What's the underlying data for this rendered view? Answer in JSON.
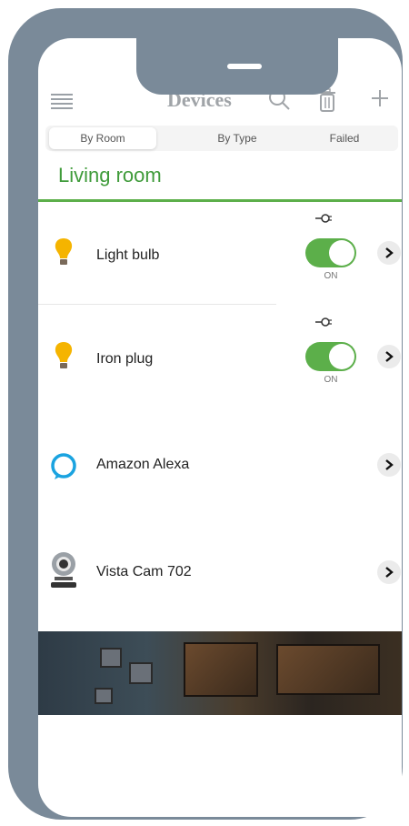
{
  "header": {
    "title": "Devices",
    "icons": [
      "menu-icon",
      "search-icon",
      "trash-icon",
      "add-icon"
    ]
  },
  "tabs": [
    {
      "label": "By Room",
      "active": true
    },
    {
      "label": "By Type",
      "active": false
    },
    {
      "label": "Failed",
      "active": false
    }
  ],
  "section": {
    "title": "Living room"
  },
  "devices": [
    {
      "name": "Light bulb",
      "icon": "lightbulb-icon",
      "toggle": "ON",
      "on": true
    },
    {
      "name": "Iron plug",
      "icon": "lightbulb-icon",
      "toggle": "ON",
      "on": true
    },
    {
      "name": "Amazon Alexa",
      "icon": "alexa-ring-icon"
    },
    {
      "name": "Vista Cam 702",
      "icon": "camera-icon"
    }
  ],
  "colors": {
    "accent_green": "#5caf4a",
    "frame_gray": "#7a8a99",
    "bulb_yellow": "#f5b400"
  }
}
